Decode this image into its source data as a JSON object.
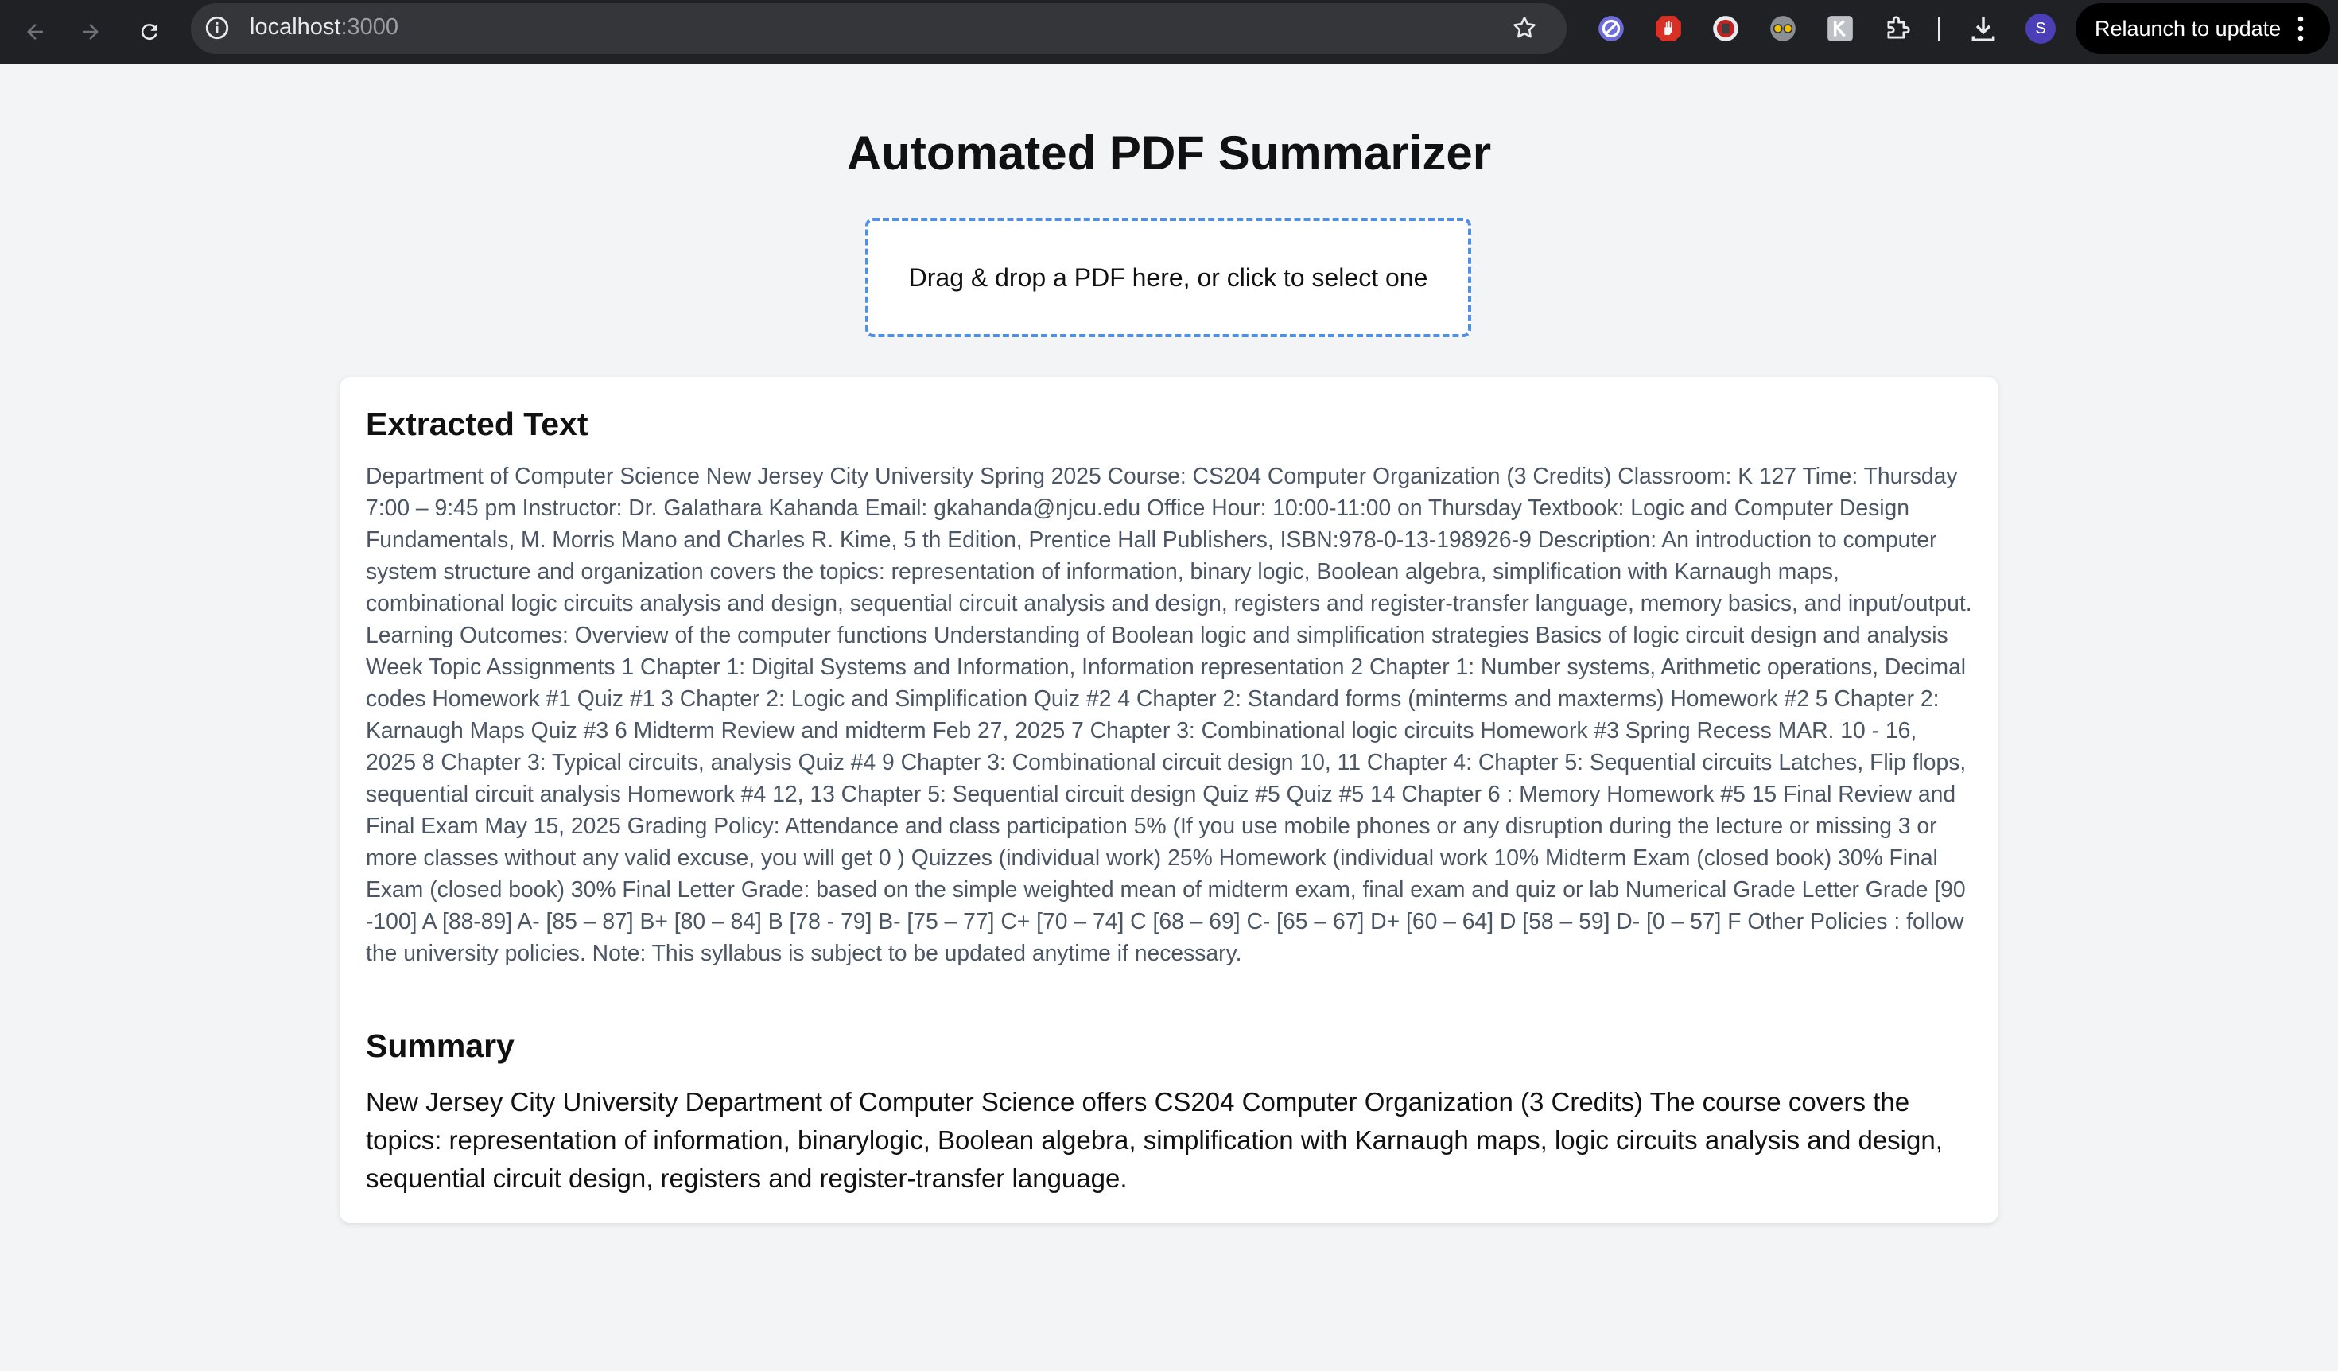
{
  "browser": {
    "url_host": "localhost",
    "url_port": ":3000",
    "relaunch_label": "Relaunch to update",
    "profile_initial": "S",
    "accent": "#4b3fb8"
  },
  "page": {
    "title": "Automated PDF Summarizer",
    "dropzone_label": "Drag & drop a PDF here, or click to select one",
    "dropzone_border_color": "#4f8fe6",
    "extracted_heading": "Extracted Text",
    "extracted_text": "Department of Computer Science New Jersey City University Spring 2025 Course: CS204 Computer Organization (3 Credits) Classroom: K 127 Time: Thursday 7:00 – 9:45 pm Instructor: Dr. Galathara Kahanda Email: gkahanda@njcu.edu Office Hour: 10:00-11:00 on Thursday Textbook: Logic and Computer Design Fundamentals, M. Morris Mano and Charles R. Kime, 5 th Edition, Prentice Hall Publishers, ISBN:978-0-13-198926-9 Description: An introduction to computer system structure and organization covers the topics: representation of information, binary logic, Boolean algebra, simplification with Karnaugh maps, combinational logic circuits analysis and design, sequential circuit analysis and design, registers and register-transfer language, memory basics, and input/output. Learning Outcomes: Overview of the computer functions Understanding of Boolean logic and simplification strategies Basics of logic circuit design and analysis Week Topic Assignments 1 Chapter 1: Digital Systems and Information, Information representation 2 Chapter 1: Number systems, Arithmetic operations, Decimal codes Homework #1 Quiz #1 3 Chapter 2: Logic and Simplification Quiz #2 4 Chapter 2: Standard forms (minterms and maxterms) Homework #2 5 Chapter 2: Karnaugh Maps Quiz #3 6 Midterm Review and midterm Feb 27, 2025 7 Chapter 3: Combinational logic circuits Homework #3 Spring Recess MAR. 10 - 16, 2025 8 Chapter 3: Typical circuits, analysis Quiz #4 9 Chapter 3: Combinational circuit design 10, 11 Chapter 4: Chapter 5: Sequential circuits Latches, Flip flops, sequential circuit analysis Homework #4 12, 13 Chapter 5: Sequential circuit design Quiz #5 Quiz #5 14 Chapter 6 : Memory Homework #5 15 Final Review and Final Exam May 15, 2025 Grading Policy: Attendance and class participation 5% (If you use mobile phones or any disruption during the lecture or missing 3 or more classes without any valid excuse, you will get 0 ) Quizzes (individual work) 25% Homework (individual work 10% Midterm Exam (closed book) 30% Final Exam (closed book) 30% Final Letter Grade: based on the simple weighted mean of midterm exam, final exam and quiz or lab Numerical Grade Letter Grade [90 -100] A [88-89] A- [85 – 87] B+ [80 – 84] B [78 - 79] B- [75 – 77] C+ [70 – 74] C [68 – 69] C- [65 – 67] D+ [60 – 64] D [58 – 59] D- [0 – 57] F Other Policies : follow the university policies. Note: This syllabus is subject to be updated anytime if necessary.",
    "summary_heading": "Summary",
    "summary_text": "New Jersey City University Department of Computer Science offers CS204 Computer Organization (3 Credits) The course covers the topics: representation of information, binarylogic, Boolean algebra, simplification with Karnaugh maps, logic circuits analysis and design, sequential circuit design, registers and register-transfer language."
  }
}
